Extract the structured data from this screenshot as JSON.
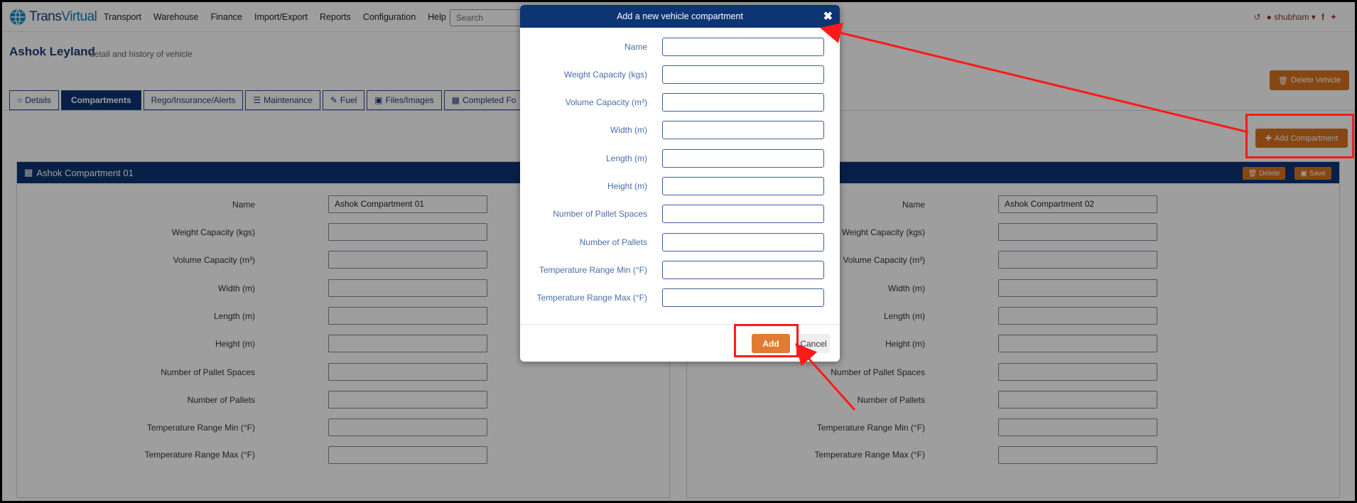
{
  "app": {
    "logo_prefix": "Trans",
    "logo_suffix": "Virtual"
  },
  "nav": {
    "items": [
      "Transport",
      "Warehouse",
      "Finance",
      "Import/Export",
      "Reports",
      "Configuration",
      "Help"
    ],
    "search_placeholder": "Search",
    "username": "shubham"
  },
  "page": {
    "title": "Ashok Leyland",
    "subtitle": "detail and history of vehicle",
    "delete_vehicle_label": "Delete Vehicle",
    "add_compartment_label": "Add Compartment"
  },
  "tabs": [
    {
      "label": "Details",
      "icon": "circle-icon",
      "active": false
    },
    {
      "label": "Compartments",
      "icon": "",
      "active": true
    },
    {
      "label": "Rego/Insurance/Alerts",
      "icon": "",
      "active": false
    },
    {
      "label": "Maintenance",
      "icon": "list-icon",
      "active": false
    },
    {
      "label": "Fuel",
      "icon": "pencil-icon",
      "active": false
    },
    {
      "label": "Files/Images",
      "icon": "image-icon",
      "active": false
    },
    {
      "label": "Completed Fo",
      "icon": "calendar-icon",
      "active": false
    }
  ],
  "field_labels": [
    "Name",
    "Weight Capacity (kgs)",
    "Volume Capacity (m³)",
    "Width (m)",
    "Length (m)",
    "Height (m)",
    "Number of Pallet Spaces",
    "Number of Pallets",
    "Temperature Range Min (°F)",
    "Temperature Range Max (°F)"
  ],
  "compartments": [
    {
      "title": "Ashok Compartment 01",
      "name_value": "Ashok Compartment 01"
    },
    {
      "title": "",
      "name_value": "Ashok Compartment 02",
      "delete_label": "Delete",
      "save_label": "Save"
    }
  ],
  "modal": {
    "title": "Add a new vehicle compartment",
    "add_label": "Add",
    "cancel_label": "Cancel"
  },
  "colors": {
    "navy": "#0d3473",
    "orange": "#d8731f",
    "annotation_red": "#ff1a1a"
  }
}
